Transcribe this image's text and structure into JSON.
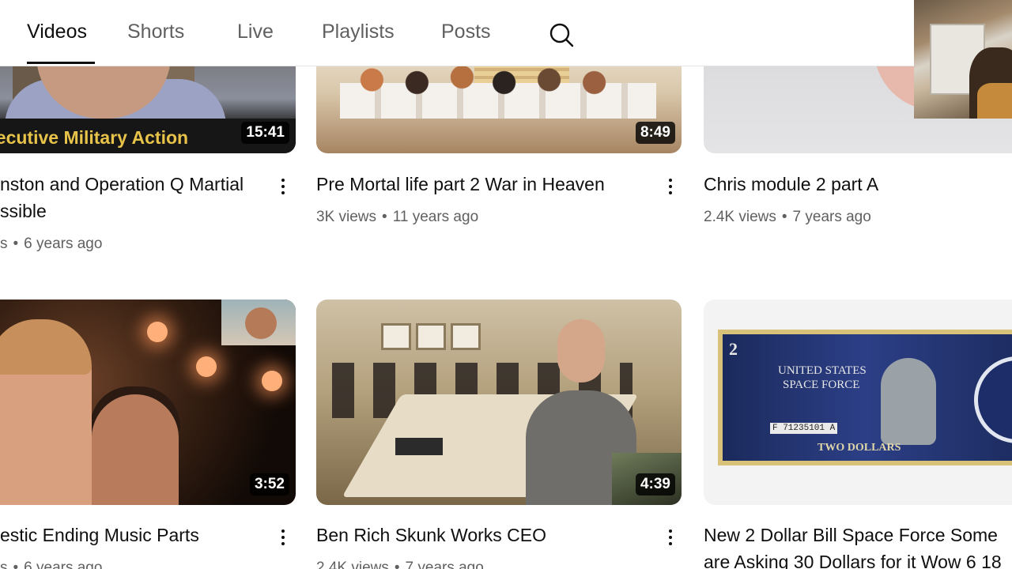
{
  "tabs": [
    {
      "label": "Videos",
      "active": true
    },
    {
      "label": "Shorts",
      "active": false
    },
    {
      "label": "Live",
      "active": false
    },
    {
      "label": "Playlists",
      "active": false
    },
    {
      "label": "Posts",
      "active": false
    }
  ],
  "videos": [
    {
      "title_line1": "nston and Operation Q Martial",
      "title_line2": "ssible",
      "views": "s",
      "age": "6 years ago",
      "duration": "15:41",
      "thumb_text": "xecutive Military Action"
    },
    {
      "title_line1": "Pre Mortal life part 2 War in Heaven",
      "views": "3K views",
      "age": "11 years ago",
      "duration": "8:49"
    },
    {
      "title_line1": "Chris module 2 part A",
      "views": "2.4K views",
      "age": "7 years ago"
    },
    {
      "title_line1": "estic Ending Music Parts",
      "views": "s",
      "age": "6 years ago",
      "duration": "3:52"
    },
    {
      "title_line1": "Ben Rich Skunk Works CEO",
      "views": "2.4K views",
      "age": "7 years ago",
      "duration": "4:39"
    },
    {
      "title_line1": "New 2 Dollar Bill Space Force Some",
      "title_line2": "are Asking 30 Dollars for it Wow 6 18",
      "bill_denom": "2",
      "bill_text1": "UNITED STATES",
      "bill_text2": "SPACE FORCE",
      "bill_serial": "F 71235101 A",
      "bill_bottom": "TWO DOLLARS"
    }
  ],
  "colors": {
    "text_primary": "#0f0f0f",
    "text_secondary": "#606060",
    "duration_bg": "#000000cc"
  }
}
